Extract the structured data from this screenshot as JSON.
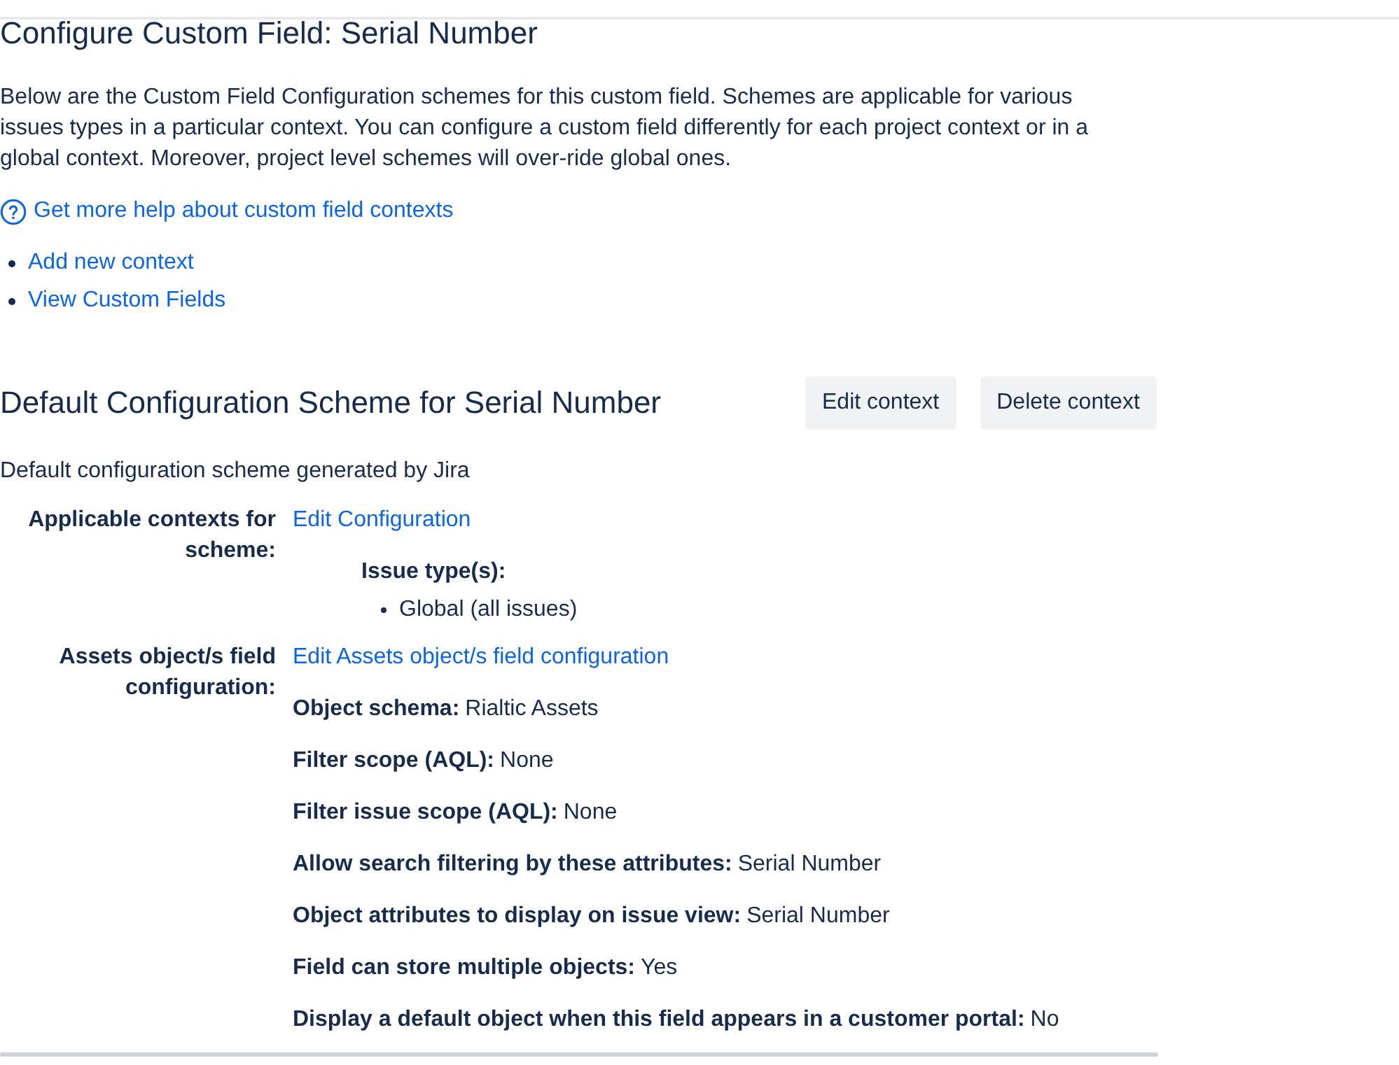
{
  "page": {
    "title": "Configure Custom Field: Serial Number",
    "description": "Below are the Custom Field Configuration schemes for this custom field. Schemes are applicable for various issues types in a particular context. You can configure a custom field differently for each project context or in a global context. Moreover, project level schemes will over-ride global ones.",
    "help_link": "Get more help about custom field contexts",
    "links": [
      "Add new context",
      "View Custom Fields"
    ]
  },
  "scheme": {
    "title": "Default Configuration Scheme for Serial Number",
    "buttons": [
      "Edit context",
      "Delete context"
    ],
    "description": "Default configuration scheme generated by Jira",
    "rows": [
      {
        "kind": "issue_types",
        "label": "Applicable contexts for scheme:",
        "link": "Edit Configuration",
        "heading": "Issue type(s):",
        "items": [
          "Global (all issues)"
        ]
      },
      {
        "kind": "properties",
        "label": "Assets object/s field configuration:",
        "link": "Edit Assets object/s field configuration",
        "properties": [
          {
            "name": "Object schema:",
            "value": "Rialtic Assets"
          },
          {
            "name": "Filter scope (AQL):",
            "value": "None"
          },
          {
            "name": "Filter issue scope (AQL):",
            "value": "None"
          },
          {
            "name": "Allow search filtering by these attributes:",
            "value": "Serial Number"
          },
          {
            "name": "Object attributes to display on issue view:",
            "value": "Serial Number"
          },
          {
            "name": "Field can store multiple objects:",
            "value": "Yes"
          },
          {
            "name": "Display a default object when this field appears in a customer portal:",
            "value": "No"
          }
        ]
      }
    ]
  }
}
